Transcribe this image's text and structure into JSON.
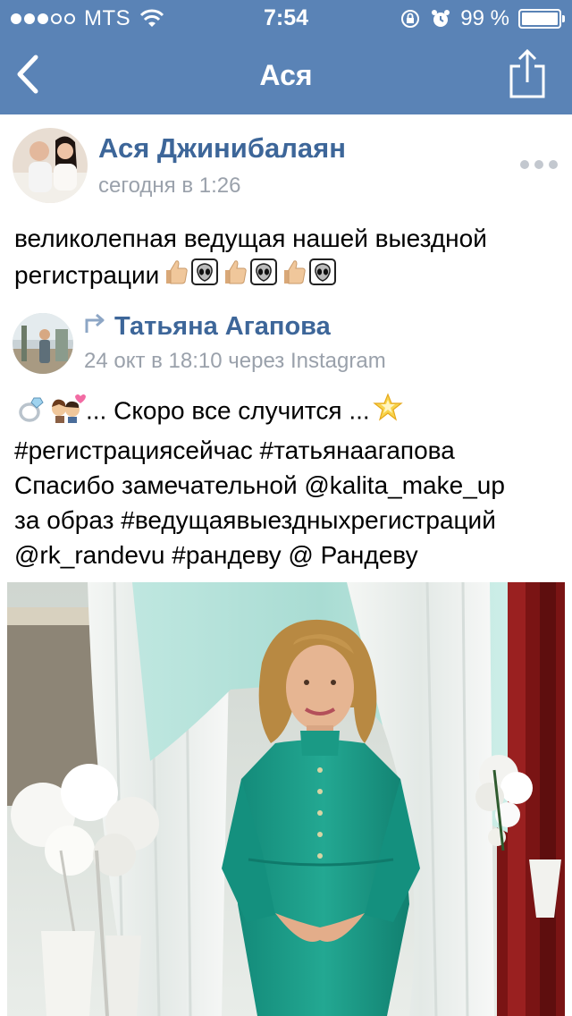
{
  "status_bar": {
    "carrier": "MTS",
    "time": "7:54",
    "battery": "99 %",
    "battery_level": 0.99
  },
  "nav": {
    "title": "Ася"
  },
  "post": {
    "author": "Ася Джинибалаян",
    "date": "сегодня в 1:26",
    "text": "великолепная ведущая нашей выездной регистрации"
  },
  "repost": {
    "author": "Татьяна Агапова",
    "date": "24 окт в 18:10 через Instagram",
    "line1": "... Скоро все случится ...",
    "line2": "#регистрациясейчас #татьянаагапова",
    "line3": "Спасибо замечательной @kalita_make_up",
    "line4": "за образ #ведущаявыездныхрегистраций",
    "line5": "@rk_randevu #рандеву @ Рандеву"
  },
  "icons": {
    "back": "chevron-left-icon",
    "share": "share-icon",
    "more": "more-dots-icon",
    "repost": "repost-arrow-icon",
    "wifi": "wifi-icon",
    "lock": "orientation-lock-icon",
    "alarm": "alarm-icon"
  },
  "colors": {
    "header": "#5a83b6",
    "link": "#3d6699",
    "meta": "#9aa1ab"
  }
}
